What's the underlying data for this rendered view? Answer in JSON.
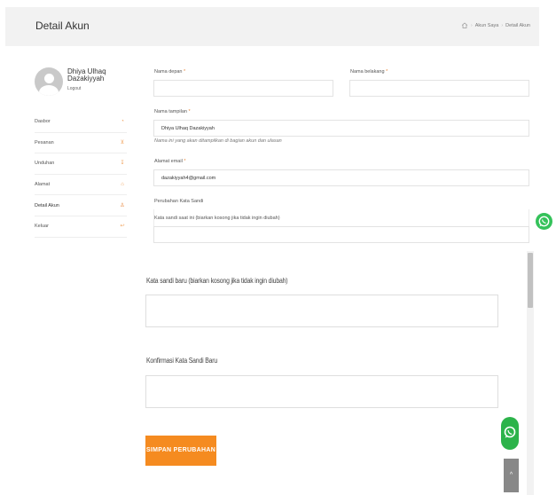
{
  "header": {
    "title": "Detail Akun",
    "breadcrumb": [
      "Akun Saya",
      "Detail Akun"
    ]
  },
  "profile": {
    "name": "Dhiya Ulhaq Dazakiyyah",
    "logout": "Logout"
  },
  "sidebar": {
    "items": [
      {
        "label": "Dasbor",
        "icon": "dashboard-icon"
      },
      {
        "label": "Pesanan",
        "icon": "cart-icon"
      },
      {
        "label": "Unduhan",
        "icon": "download-icon"
      },
      {
        "label": "Alamat",
        "icon": "location-icon"
      },
      {
        "label": "Detail Akun",
        "icon": "user-icon"
      },
      {
        "label": "Keluar",
        "icon": "logout-icon"
      }
    ]
  },
  "form": {
    "first_name_label": "Nama depan",
    "first_name_value": "",
    "last_name_label": "Nama belakang",
    "last_name_value": "",
    "display_name_label": "Nama tampilan",
    "display_name_value": "Dhiya Ulhaq Dazakiyyah",
    "display_name_hint": "Nama ini yang akan ditampilkan di bagian akun dan ulasan",
    "email_label": "Alamat email",
    "email_value": "dazakiyyah4@gmail.com",
    "password_section": "Perubahan Kata Sandi",
    "current_password_label": "Kata sandi saat ini (biarkan kosong jika tidak ingin diubah)",
    "current_password_value": "",
    "required_mark": "*"
  },
  "lower_form": {
    "new_password_label": "Kata sandi baru (biarkan kosong jika tidak ingin diubah)",
    "confirm_password_label": "Konfirmasi Kata Sandi Baru",
    "save_label": "SIMPAN PERUBAHAN"
  },
  "floating": {
    "back_to_top": "^"
  },
  "colors": {
    "accent": "#f58b20",
    "whatsapp": "#2cb34a"
  }
}
